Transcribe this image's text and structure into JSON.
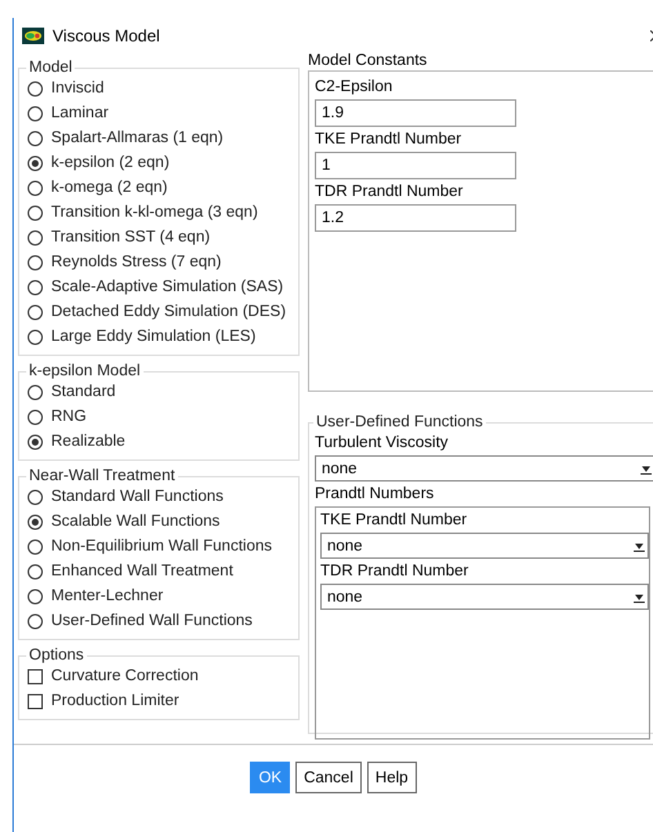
{
  "window": {
    "title": "Viscous Model"
  },
  "model": {
    "title": "Model",
    "options": [
      {
        "label": "Inviscid",
        "selected": false
      },
      {
        "label": "Laminar",
        "selected": false
      },
      {
        "label": "Spalart-Allmaras (1 eqn)",
        "selected": false
      },
      {
        "label": "k-epsilon (2 eqn)",
        "selected": true
      },
      {
        "label": "k-omega (2 eqn)",
        "selected": false
      },
      {
        "label": "Transition k-kl-omega (3 eqn)",
        "selected": false
      },
      {
        "label": "Transition SST (4 eqn)",
        "selected": false
      },
      {
        "label": "Reynolds Stress (7 eqn)",
        "selected": false
      },
      {
        "label": "Scale-Adaptive Simulation (SAS)",
        "selected": false
      },
      {
        "label": "Detached Eddy Simulation (DES)",
        "selected": false
      },
      {
        "label": "Large Eddy Simulation (LES)",
        "selected": false
      }
    ]
  },
  "k_epsilon_model": {
    "title": "k-epsilon Model",
    "options": [
      {
        "label": "Standard",
        "selected": false
      },
      {
        "label": "RNG",
        "selected": false
      },
      {
        "label": "Realizable",
        "selected": true
      }
    ]
  },
  "near_wall_treatment": {
    "title": "Near-Wall Treatment",
    "options": [
      {
        "label": "Standard Wall Functions",
        "selected": false
      },
      {
        "label": "Scalable Wall Functions",
        "selected": true
      },
      {
        "label": "Non-Equilibrium Wall Functions",
        "selected": false
      },
      {
        "label": "Enhanced Wall Treatment",
        "selected": false
      },
      {
        "label": "Menter-Lechner",
        "selected": false
      },
      {
        "label": "User-Defined Wall Functions",
        "selected": false
      }
    ]
  },
  "options": {
    "title": "Options",
    "items": [
      {
        "label": "Curvature Correction",
        "checked": false
      },
      {
        "label": "Production Limiter",
        "checked": false
      }
    ]
  },
  "model_constants": {
    "title": "Model Constants",
    "fields": [
      {
        "label": "C2-Epsilon",
        "value": "1.9"
      },
      {
        "label": "TKE Prandtl Number",
        "value": "1"
      },
      {
        "label": "TDR Prandtl Number",
        "value": "1.2"
      }
    ]
  },
  "user_defined_functions": {
    "title": "User-Defined Functions",
    "turbulent_viscosity": {
      "label": "Turbulent Viscosity",
      "value": "none"
    },
    "prandtl_numbers": {
      "title": "Prandtl Numbers",
      "fields": [
        {
          "label": "TKE Prandtl Number",
          "value": "none"
        },
        {
          "label": "TDR Prandtl Number",
          "value": "none"
        }
      ]
    }
  },
  "buttons": [
    {
      "label": "OK",
      "kind": "primary"
    },
    {
      "label": "Cancel",
      "kind": "default"
    },
    {
      "label": "Help",
      "kind": "default"
    }
  ]
}
